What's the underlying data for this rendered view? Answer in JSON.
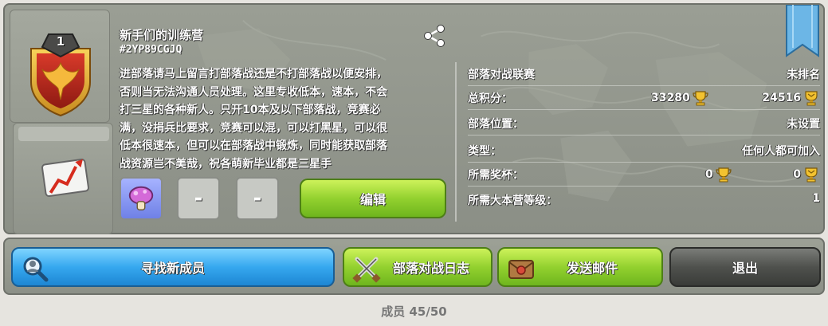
{
  "clan": {
    "level": "1",
    "name": "新手们的训练营",
    "tag": "#2YP89CGJQ",
    "description": "进部落请马上留言打部落战还是不打部落战以便安排，\n否则当无法沟通人员处理。这里专收低本，速本，不会\n打三星的各种新人。只开10本及以下部落战，竞赛必\n满，没捐兵比要求，竞赛可以混，可以打黑星，可以很\n低本很速本，但可以在部落战中锻炼，同时能获取部落\n战资源岂不美哉，祝各萌新毕业都是三星手"
  },
  "requirements": {
    "slot2": "-",
    "slot3": "-"
  },
  "edit_label": "编辑",
  "info": {
    "league_label": "部落对战联赛",
    "league_value": "未排名",
    "points_label": "总积分：",
    "points_home": "33280",
    "points_builder": "24516",
    "location_label": "部落位置：",
    "location_value": "未设置",
    "type_label": "类型：",
    "type_value": "任何人都可加入",
    "trophies_label": "所需奖杯：",
    "trophies_home": "0",
    "trophies_builder": "0",
    "th_label": "所需大本营等级：",
    "th_value": "1"
  },
  "actions": {
    "find_members": "寻找新成员",
    "war_log": "部落对战日志",
    "send_mail": "发送邮件",
    "leave": "退出"
  },
  "members": "成员 45/50",
  "colors": {
    "gold": "#f2c230",
    "blue_btn": "#36a8ef",
    "green_btn": "#93d12f",
    "grey_btn": "#4f514d"
  }
}
